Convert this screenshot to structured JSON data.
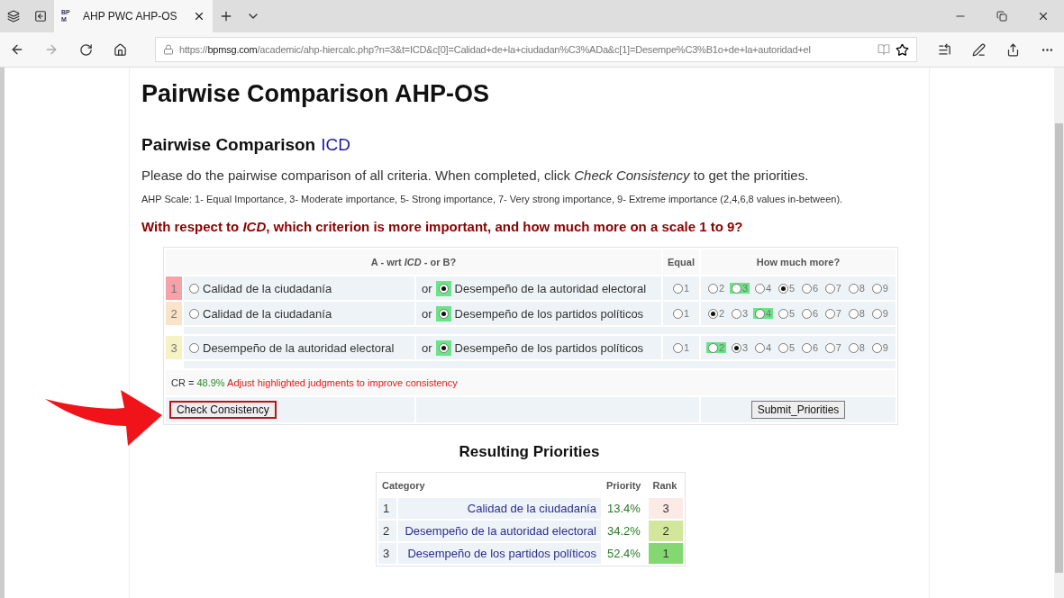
{
  "browser": {
    "tab_title": "AHP PWC AHP-OS",
    "favicon": "BP M",
    "url_scheme": "https://",
    "url_host": "bpmsg.com",
    "url_path": "/academic/ahp-hiercalc.php?n=3&t=ICD&c[0]=Calidad+de+la+ciudadan%C3%ADa&c[1]=Desempe%C3%B1o+de+la+autoridad+el"
  },
  "page": {
    "title": "Pairwise Comparison AHP-OS",
    "subtitle": "Pairwise Comparison",
    "subtitle_goal": "ICD",
    "instructions": "Please do the pairwise comparison of all criteria. When completed, click *Check Consistency* to get the priorities.",
    "scale": "AHP Scale: 1- Equal Importance, 3- Moderate importance, 5- Strong importance, 7- Very strong importance, 9- Extreme importance (2,4,6,8 values in-between).",
    "question": "With respect to *ICD*, which criterion is more important, and how much more on a scale 1 to 9?"
  },
  "form": {
    "header_ab": "A - wrt *ICD* - or B?",
    "header_equal": "Equal",
    "header_more": "How much more?",
    "rows": [
      {
        "number": "1",
        "color": "#f5a3a8",
        "a": "Calidad de la ciudadanía",
        "a_selected": false,
        "or": "or",
        "b": "Desempeño de la autoridad electoral",
        "b_selected": true,
        "b_highlighted": true,
        "options": [
          {
            "label": "1",
            "selected": false,
            "highlighted": false
          },
          {
            "label": "2",
            "selected": false,
            "highlighted": false
          },
          {
            "label": "3",
            "selected": false,
            "highlighted": true
          },
          {
            "label": "4",
            "selected": false,
            "highlighted": false
          },
          {
            "label": "5",
            "selected": true,
            "highlighted": false
          },
          {
            "label": "6",
            "selected": false,
            "highlighted": false
          },
          {
            "label": "7",
            "selected": false,
            "highlighted": false
          },
          {
            "label": "8",
            "selected": false,
            "highlighted": false
          },
          {
            "label": "9",
            "selected": false,
            "highlighted": false
          }
        ]
      },
      {
        "number": "2",
        "color": "#fbe3c8",
        "a": "Calidad de la ciudadanía",
        "a_selected": false,
        "or": "or",
        "b": "Desempeño de los partidos políticos",
        "b_selected": true,
        "b_highlighted": true,
        "options": [
          {
            "label": "1",
            "selected": false,
            "highlighted": false
          },
          {
            "label": "2",
            "selected": true,
            "highlighted": false
          },
          {
            "label": "3",
            "selected": false,
            "highlighted": false
          },
          {
            "label": "4",
            "selected": false,
            "highlighted": true
          },
          {
            "label": "5",
            "selected": false,
            "highlighted": false
          },
          {
            "label": "6",
            "selected": false,
            "highlighted": false
          },
          {
            "label": "7",
            "selected": false,
            "highlighted": false
          },
          {
            "label": "8",
            "selected": false,
            "highlighted": false
          },
          {
            "label": "9",
            "selected": false,
            "highlighted": false
          }
        ]
      },
      {
        "number": "3",
        "color": "#f6f2c4",
        "a": "Desempeño de la autoridad electoral",
        "a_selected": false,
        "or": "or",
        "b": "Desempeño de los partidos políticos",
        "b_selected": true,
        "b_highlighted": true,
        "options": [
          {
            "label": "1",
            "selected": false,
            "highlighted": false
          },
          {
            "label": "2",
            "selected": false,
            "highlighted": true
          },
          {
            "label": "3",
            "selected": true,
            "highlighted": false
          },
          {
            "label": "4",
            "selected": false,
            "highlighted": false
          },
          {
            "label": "5",
            "selected": false,
            "highlighted": false
          },
          {
            "label": "6",
            "selected": false,
            "highlighted": false
          },
          {
            "label": "7",
            "selected": false,
            "highlighted": false
          },
          {
            "label": "8",
            "selected": false,
            "highlighted": false
          },
          {
            "label": "9",
            "selected": false,
            "highlighted": false
          }
        ]
      }
    ],
    "cr_label": "CR =",
    "cr_value": "48.9%",
    "cr_message": "Adjust highlighted judgments to improve consistency",
    "check_button": "Check Consistency",
    "submit_button": "Submit_Priorities"
  },
  "results": {
    "title": "Resulting Priorities",
    "columns": [
      "Category",
      "Priority",
      "Rank"
    ],
    "rows": [
      {
        "number": "1",
        "category": "Calidad de la ciudadanía",
        "priority": "13.4%",
        "rank": "3",
        "color": "#fbeae6"
      },
      {
        "number": "2",
        "category": "Desempeño de la autoridad electoral",
        "priority": "34.2%",
        "rank": "2",
        "color": "#d2e69c"
      },
      {
        "number": "3",
        "category": "Desempeño de los partidos políticos",
        "priority": "52.4%",
        "rank": "1",
        "color": "#84d871"
      }
    ]
  }
}
